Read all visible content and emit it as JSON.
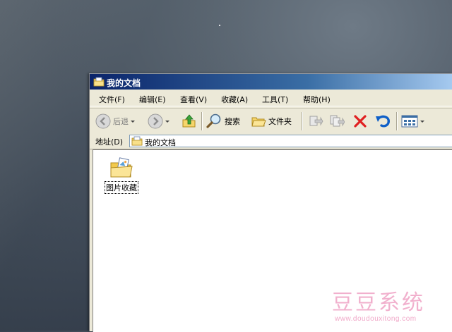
{
  "window": {
    "title": "我的文档"
  },
  "menu": {
    "items": [
      "文件(F)",
      "编辑(E)",
      "查看(V)",
      "收藏(A)",
      "工具(T)",
      "帮助(H)"
    ]
  },
  "toolbar": {
    "back_label": "后退",
    "search_label": "搜索",
    "folders_label": "文件夹"
  },
  "address": {
    "label": "地址(D)",
    "value": "我的文档"
  },
  "files": [
    {
      "name": "图片收藏",
      "icon": "pictures-folder-icon"
    }
  ],
  "watermark": {
    "text": "豆豆系统",
    "url": "www.doudouxitong.com"
  },
  "colors": {
    "title_bar": "#0a246a",
    "chrome": "#ece9d8",
    "delete_red": "#e02020",
    "undo_blue": "#1060c8"
  }
}
